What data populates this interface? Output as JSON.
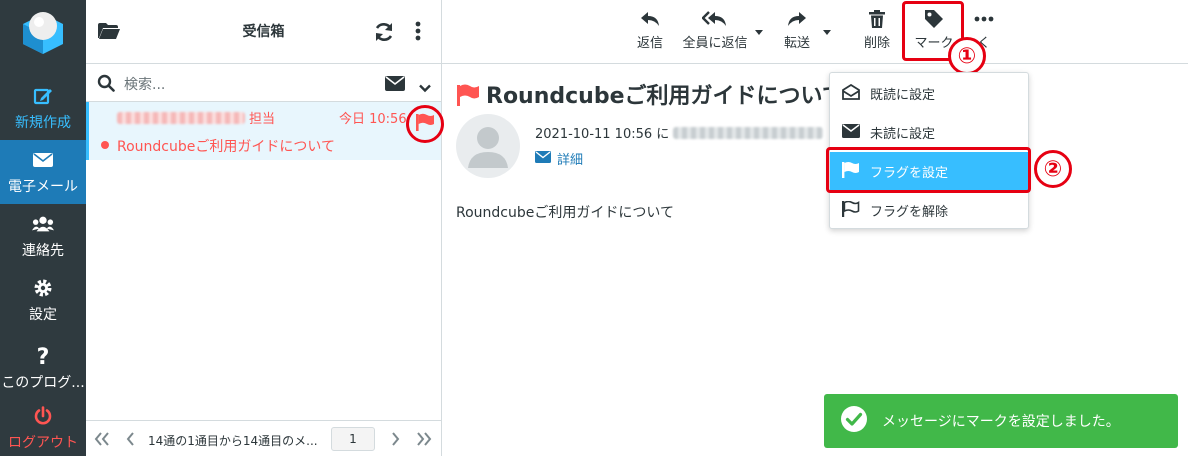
{
  "colors": {
    "nav_bg": "#2f3a3f",
    "accent": "#37beff",
    "active_nav": "#1e7bb7",
    "flag_red": "#ff5552",
    "annotation_red": "#e60012",
    "toast_green": "#41b849"
  },
  "nav": {
    "items": [
      {
        "label": "新規作成",
        "icon": "compose-icon"
      },
      {
        "label": "電子メール",
        "icon": "envelope-icon"
      },
      {
        "label": "連絡先",
        "icon": "users-icon"
      },
      {
        "label": "設定",
        "icon": "gear-icon"
      },
      {
        "label": "このプログ...",
        "icon": "question-icon"
      },
      {
        "label": "ログアウト",
        "icon": "power-icon"
      }
    ]
  },
  "list": {
    "title": "受信箱",
    "search_placeholder": "検索...",
    "message": {
      "from_suffix": "担当",
      "date": "今日 10:56",
      "subject": "Roundcubeご利用ガイドについて"
    },
    "footer": {
      "count": "14通の1通目から14通目のメ...",
      "page": "1"
    }
  },
  "toolbar": {
    "reply": "返信",
    "reply_all": "全員に返信",
    "forward": "転送",
    "delete": "削除",
    "mark": "マーク",
    "more": "く"
  },
  "annotations": {
    "step1": "①",
    "step2": "②"
  },
  "message": {
    "subject": "Roundcubeご利用ガイドについて",
    "date_prefix": "2021-10-11 10:56 に",
    "details": "詳細",
    "body": "Roundcubeご利用ガイドについて"
  },
  "mark_menu": {
    "items": [
      {
        "label": "既読に設定",
        "icon": "envelope-open-icon"
      },
      {
        "label": "未読に設定",
        "icon": "envelope-icon"
      },
      {
        "label": "フラグを設定",
        "icon": "flag-icon"
      },
      {
        "label": "フラグを解除",
        "icon": "flag-outline-icon"
      }
    ]
  },
  "toast": {
    "text": "メッセージにマークを設定しました。"
  }
}
